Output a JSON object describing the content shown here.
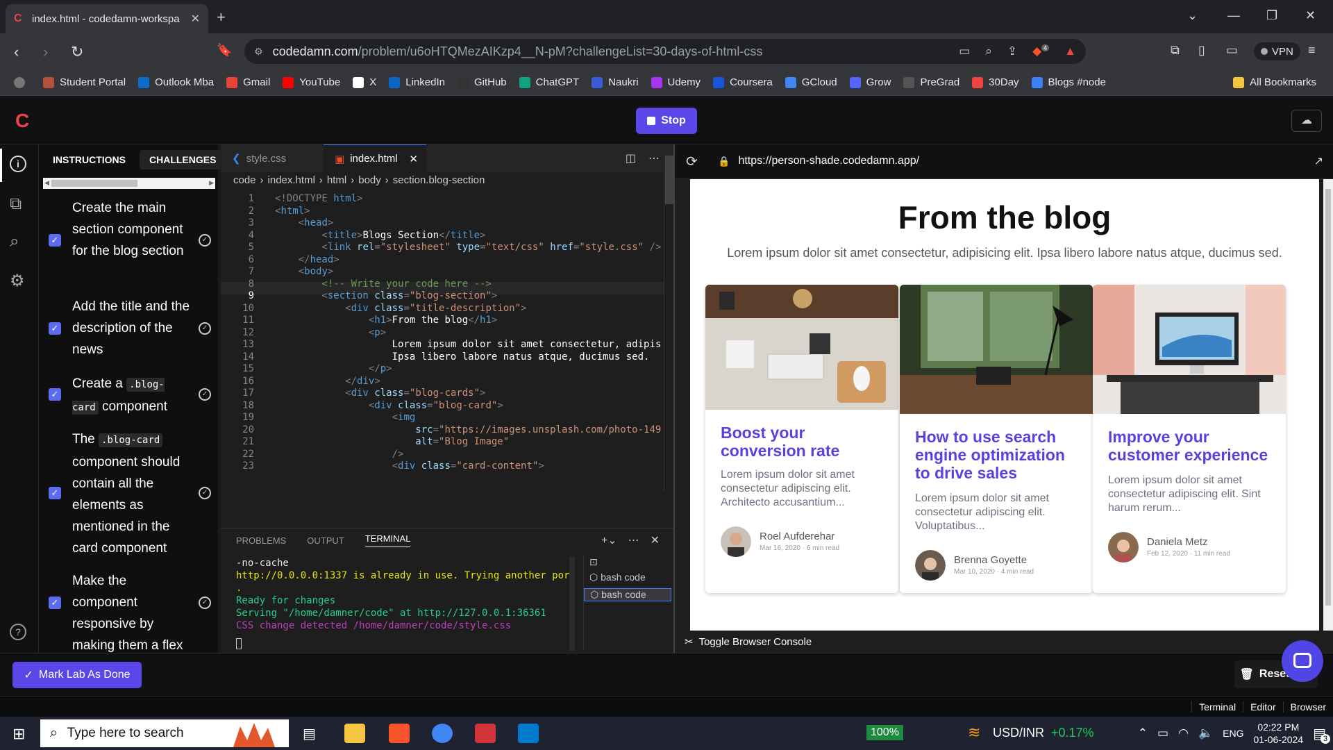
{
  "chrome": {
    "tab_title": "index.html - codedamn-workspa",
    "url_host": "codedamn.com",
    "url_path": "/problem/u6oHTQMezAIKzp4__N-pM?challengeList=30-days-of-html-css",
    "vpn_label": "VPN",
    "ext_badge": "4",
    "bookmarks": [
      "Student Portal",
      "Outlook Mba",
      "Gmail",
      "YouTube",
      "X",
      "LinkedIn",
      "GitHub",
      "ChatGPT",
      "Naukri",
      "Udemy",
      "Coursera",
      "GCloud",
      "Grow",
      "PreGrad",
      "30Day",
      "Blogs #node"
    ],
    "bookmark_colors": [
      "#b5523b",
      "#0b6cc9",
      "#ea4335",
      "#ff0000",
      "#ffffff",
      "#0a66c2",
      "#333333",
      "#10a37f",
      "#3b5bdb",
      "#a435f0",
      "#1a56db",
      "#4285f4",
      "#5367ff",
      "#555555",
      "#ef4444",
      "#3b82f6"
    ],
    "all_bookmarks": "All Bookmarks"
  },
  "app": {
    "logo": "C",
    "stop_label": "Stop"
  },
  "instructions": {
    "tab_instructions": "INSTRUCTIONS",
    "tab_challenges": "CHALLENGES",
    "tasks": [
      {
        "before": "Create the main section component for the blog section",
        "code": "",
        "after": ""
      },
      {
        "before": "Add the title and the description of the news",
        "code": "",
        "after": ""
      },
      {
        "before": "Create a ",
        "code": ".blog-card",
        "after": " component"
      },
      {
        "before": "The ",
        "code": ".blog-card",
        "after": " component should contain all the elements as mentioned in the card component"
      },
      {
        "before": "Make the component responsive by making them a flex",
        "code": "",
        "after": ""
      }
    ]
  },
  "editor": {
    "tabs": [
      "style.css",
      "index.html"
    ],
    "breadcrumb": [
      "code",
      "index.html",
      "html",
      "body",
      "section.blog-section"
    ],
    "current_line": 9,
    "lines": [
      [
        [
          "pu",
          "<!DOCTYPE "
        ],
        [
          "tg",
          "html"
        ],
        [
          "pu",
          ">"
        ]
      ],
      [
        [
          "pu",
          "<"
        ],
        [
          "tg",
          "html"
        ],
        [
          "pu",
          ">"
        ]
      ],
      [
        [
          "pu",
          "    <"
        ],
        [
          "tg",
          "head"
        ],
        [
          "pu",
          ">"
        ]
      ],
      [
        [
          "pu",
          "        <"
        ],
        [
          "tg",
          "title"
        ],
        [
          "pu",
          ">"
        ],
        [
          "tx",
          "Blogs Section"
        ],
        [
          "pu",
          "</"
        ],
        [
          "tg",
          "title"
        ],
        [
          "pu",
          ">"
        ]
      ],
      [
        [
          "pu",
          "        <"
        ],
        [
          "tg",
          "link "
        ],
        [
          "at",
          "rel"
        ],
        [
          "pu",
          "="
        ],
        [
          "st",
          "\"stylesheet\" "
        ],
        [
          "at",
          "type"
        ],
        [
          "pu",
          "="
        ],
        [
          "st",
          "\"text/css\" "
        ],
        [
          "at",
          "href"
        ],
        [
          "pu",
          "="
        ],
        [
          "st",
          "\"style.css\" "
        ],
        [
          "pu",
          "/>"
        ]
      ],
      [
        [
          "pu",
          "    </"
        ],
        [
          "tg",
          "head"
        ],
        [
          "pu",
          ">"
        ]
      ],
      [
        [
          "pu",
          "    <"
        ],
        [
          "tg",
          "body"
        ],
        [
          "pu",
          ">"
        ]
      ],
      [
        [
          "cm",
          "        <!-- Write your code here -->"
        ]
      ],
      [
        [
          "pu",
          "        <"
        ],
        [
          "tg",
          "section "
        ],
        [
          "at",
          "class"
        ],
        [
          "pu",
          "="
        ],
        [
          "st",
          "\"blog-section\""
        ],
        [
          "pu",
          ">"
        ]
      ],
      [
        [
          "pu",
          "            <"
        ],
        [
          "tg",
          "div "
        ],
        [
          "at",
          "class"
        ],
        [
          "pu",
          "="
        ],
        [
          "st",
          "\"title-description\""
        ],
        [
          "pu",
          ">"
        ]
      ],
      [
        [
          "pu",
          "                <"
        ],
        [
          "tg",
          "h1"
        ],
        [
          "pu",
          ">"
        ],
        [
          "tx",
          "From the blog"
        ],
        [
          "pu",
          "</"
        ],
        [
          "tg",
          "h1"
        ],
        [
          "pu",
          ">"
        ]
      ],
      [
        [
          "pu",
          "                <"
        ],
        [
          "tg",
          "p"
        ],
        [
          "pu",
          ">"
        ]
      ],
      [
        [
          "tx",
          "                    Lorem ipsum dolor sit amet consectetur, adipis"
        ]
      ],
      [
        [
          "tx",
          "                    Ipsa libero labore natus atque, ducimus sed."
        ]
      ],
      [
        [
          "pu",
          "                </"
        ],
        [
          "tg",
          "p"
        ],
        [
          "pu",
          ">"
        ]
      ],
      [
        [
          "pu",
          "            </"
        ],
        [
          "tg",
          "div"
        ],
        [
          "pu",
          ">"
        ]
      ],
      [
        [
          "pu",
          "            <"
        ],
        [
          "tg",
          "div "
        ],
        [
          "at",
          "class"
        ],
        [
          "pu",
          "="
        ],
        [
          "st",
          "\"blog-cards\""
        ],
        [
          "pu",
          ">"
        ]
      ],
      [
        [
          "pu",
          "                <"
        ],
        [
          "tg",
          "div "
        ],
        [
          "at",
          "class"
        ],
        [
          "pu",
          "="
        ],
        [
          "st",
          "\"blog-card\""
        ],
        [
          "pu",
          ">"
        ]
      ],
      [
        [
          "pu",
          "                    <"
        ],
        [
          "tg",
          "img"
        ]
      ],
      [
        [
          "at",
          "                        src"
        ],
        [
          "pu",
          "="
        ],
        [
          "st",
          "\"https://images.unsplash.com/photo-149"
        ]
      ],
      [
        [
          "at",
          "                        alt"
        ],
        [
          "pu",
          "="
        ],
        [
          "st",
          "\"Blog Image\""
        ]
      ],
      [
        [
          "pu",
          "                    />"
        ]
      ],
      [
        [
          "pu",
          "                    <"
        ],
        [
          "tg",
          "div "
        ],
        [
          "at",
          "class"
        ],
        [
          "pu",
          "="
        ],
        [
          "st",
          "\"card-content\""
        ],
        [
          "pu",
          ">"
        ]
      ]
    ]
  },
  "terminal": {
    "tabs": [
      "PROBLEMS",
      "OUTPUT",
      "TERMINAL"
    ],
    "lines": [
      {
        "text": "-no-cache",
        "color": "#e6e6e6"
      },
      {
        "text": "http://0.0.0.0:1337 is already in use. Trying another port",
        "color": "#e5e510"
      },
      {
        "text": ".",
        "color": "#e5e510"
      },
      {
        "text": "Ready for changes",
        "color": "#23d18b"
      },
      {
        "text": "Serving \"/home/damner/code\" at http://127.0.0.1:36361",
        "color": "#23d18b"
      },
      {
        "text": "CSS change detected /home/damner/code/style.css",
        "color": "#bc3fbc"
      }
    ],
    "shells": [
      "bash  code",
      "bash  code"
    ]
  },
  "browser": {
    "url": "https://person-shade.codedamn.app/",
    "title": "From the blog",
    "subtitle": "Lorem ipsum dolor sit amet consectetur, adipisicing elit. Ipsa libero labore natus atque, ducimus sed.",
    "cards": [
      {
        "title": "Boost your conversion rate",
        "desc": "Lorem ipsum dolor sit amet consectetur adipiscing elit. Architecto accusantium...",
        "author": "Roel Aufderehar",
        "meta": "Mar 16, 2020 · 6 min read"
      },
      {
        "title": "How to use search engine optimization to drive sales",
        "desc": "Lorem ipsum dolor sit amet consectetur adipiscing elit. Voluptatibus...",
        "author": "Brenna Goyette",
        "meta": "Mar 10, 2020 · 4 min read"
      },
      {
        "title": "Improve your customer experience",
        "desc": "Lorem ipsum dolor sit amet consectetur adipiscing elit. Sint harum rerum...",
        "author": "Daniela Metz",
        "meta": "Feb 12, 2020 · 11 min read"
      }
    ],
    "console_label": "Toggle Browser Console"
  },
  "footer": {
    "mark_done": "Mark Lab As Done",
    "reset": "Reset Lab",
    "views": [
      "Terminal",
      "Editor",
      "Browser"
    ]
  },
  "taskbar": {
    "search_placeholder": "Type here to search",
    "battery": "100%",
    "ticker": "USD/INR",
    "ticker_change": "+0.17%",
    "lang": "ENG",
    "time": "02:22 PM",
    "date": "01-06-2024",
    "notif": "3"
  }
}
